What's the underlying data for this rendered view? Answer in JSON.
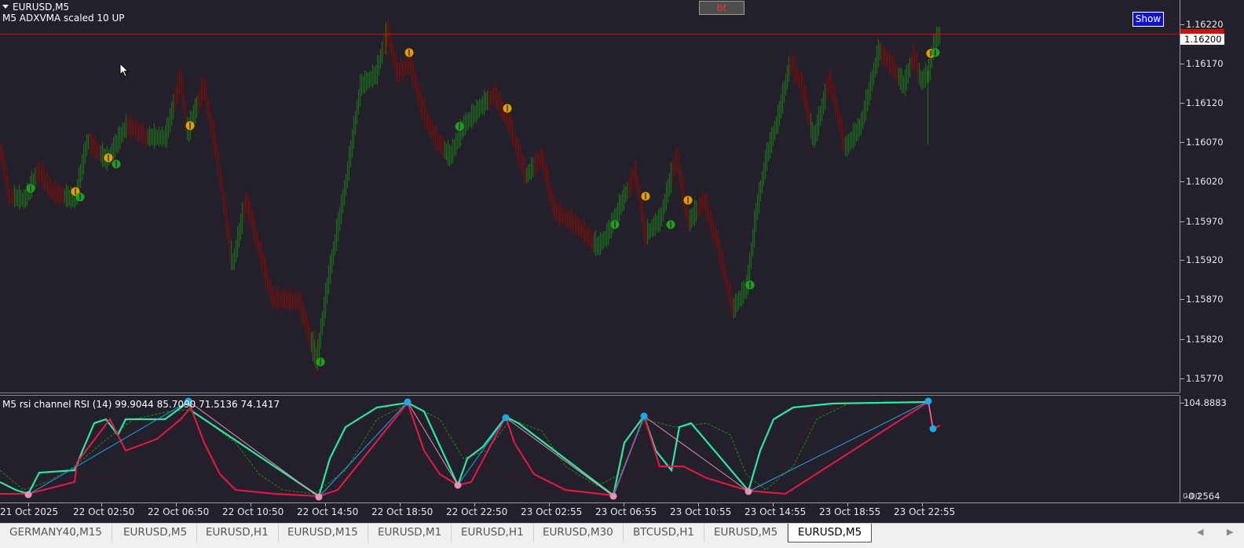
{
  "chart": {
    "title": "EURUSD,M5",
    "indicator_label": "M5 ADXVMA scaled 10 UP",
    "bt_label": "bt",
    "show_label": "Show",
    "current_price": "1.16200",
    "price_axis": [
      "1.16220",
      "1.16170",
      "1.16120",
      "1.16070",
      "1.16020",
      "1.15970",
      "1.15920",
      "1.15870",
      "1.15820",
      "1.15770"
    ],
    "colors": {
      "up_bar": "#1e6b1e",
      "down_bar": "#6b1212",
      "buy_marker": "#1ea01e",
      "sell_marker": "#e0a000",
      "price_line": "#cc1111"
    }
  },
  "subwindow": {
    "label": "M5 rsi channel RSI (14) 99.9044 85.7090 71.5136 74.1417",
    "axis_top": "104.8883",
    "axis_bottom": "-0.2564",
    "axis_bottom_overlay": "0.00",
    "colors": {
      "rsi_up": "#2de8a0",
      "rsi_down": "#e8184a",
      "channel": "#1f8f1f",
      "zigzag_up": "#19a8e8",
      "zigzag_down": "#e890b8"
    }
  },
  "time_axis": [
    "21 Oct 2025",
    "22 Oct 02:50",
    "22 Oct 06:50",
    "22 Oct 10:50",
    "22 Oct 14:50",
    "22 Oct 18:50",
    "22 Oct 22:50",
    "23 Oct 02:55",
    "23 Oct 06:55",
    "23 Oct 10:55",
    "23 Oct 14:55",
    "23 Oct 18:55",
    "23 Oct 22:55"
  ],
  "tabs": [
    "GERMANY40,M15",
    "EURUSD,M5",
    "EURUSD,H1",
    "EURUSD,M15",
    "EURUSD,M1",
    "EURUSD,H1",
    "EURUSD,M30",
    "BTCUSD,H1",
    "EURUSD,M5",
    "EURUSD,M5"
  ],
  "active_tab": 9
}
